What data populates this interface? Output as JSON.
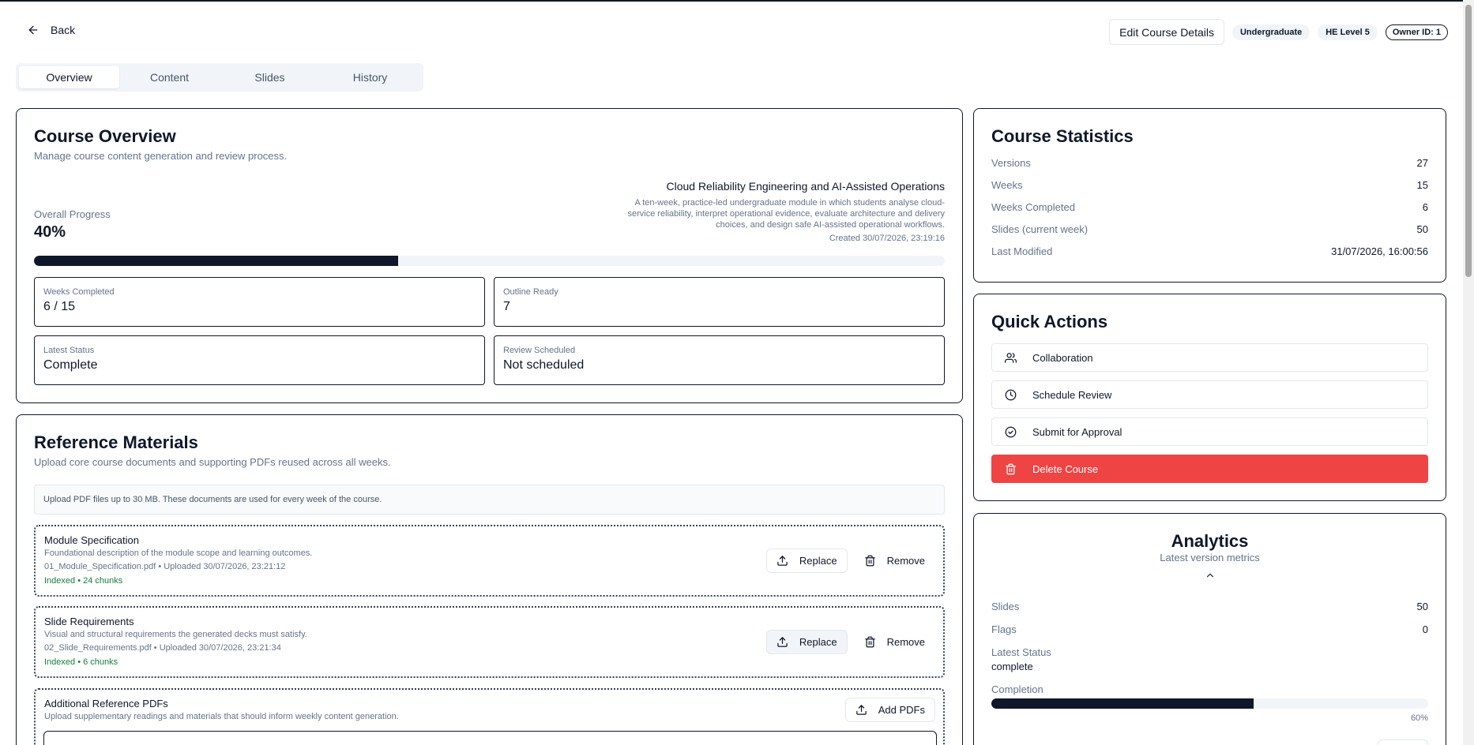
{
  "header": {
    "back_label": "Back",
    "edit_label": "Edit Course Details",
    "badges": [
      "Undergraduate",
      "HE Level 5"
    ],
    "owner_badge": "Owner ID: 1"
  },
  "tabs": [
    {
      "label": "Overview",
      "active": true
    },
    {
      "label": "Content",
      "active": false
    },
    {
      "label": "Slides",
      "active": false
    },
    {
      "label": "History",
      "active": false
    }
  ],
  "overview": {
    "title": "Course Overview",
    "subtitle": "Manage course content generation and review process.",
    "course_name": "Cloud Reliability Engineering and AI-Assisted Operations",
    "course_description": "A ten-week, practice-led undergraduate module in which students analyse cloud-service reliability, interpret operational evidence, evaluate architecture and delivery choices, and design safe AI-assisted operational workflows.",
    "created": "Created 30/07/2026, 23:19:16",
    "progress_label": "Overall Progress",
    "progress_value": "40%",
    "progress_fraction": 0.4,
    "boxes": [
      {
        "label": "Weeks Completed",
        "value": "6 / 15"
      },
      {
        "label": "Outline Ready",
        "value": "7"
      },
      {
        "label": "Latest Status",
        "value": "Complete"
      },
      {
        "label": "Review Scheduled",
        "value": "Not scheduled"
      }
    ]
  },
  "reference": {
    "title": "Reference Materials",
    "subtitle": "Upload core course documents and supporting PDFs reused across all weeks.",
    "info": "Upload PDF files up to 30 MB. These documents are used for every week of the course.",
    "items": [
      {
        "title": "Module Specification",
        "description": "Foundational description of the module scope and learning outcomes.",
        "file": "01_Module_Specification.pdf • Uploaded 30/07/2026, 23:21:12",
        "index": "Indexed • 24 chunks"
      },
      {
        "title": "Slide Requirements",
        "description": "Visual and structural requirements the generated decks must satisfy.",
        "file": "02_Slide_Requirements.pdf • Uploaded 30/07/2026, 23:21:34",
        "index": "Indexed • 6 chunks"
      }
    ],
    "replace_label": "Replace",
    "remove_label": "Remove",
    "additional": {
      "title": "Additional Reference PDFs",
      "description": "Upload supplementary readings and materials that should inform weekly content generation.",
      "add_label": "Add PDFs"
    }
  },
  "statistics": {
    "title": "Course Statistics",
    "rows": [
      {
        "key": "Versions",
        "value": "27"
      },
      {
        "key": "Weeks",
        "value": "15"
      },
      {
        "key": "Weeks Completed",
        "value": "6"
      },
      {
        "key": "Slides (current week)",
        "value": "50"
      },
      {
        "key": "Last Modified",
        "value": "31/07/2026, 16:00:56"
      }
    ]
  },
  "quick_actions": {
    "title": "Quick Actions",
    "items": [
      {
        "label": "Collaboration",
        "icon": "users-icon"
      },
      {
        "label": "Schedule Review",
        "icon": "clock-icon"
      },
      {
        "label": "Submit for Approval",
        "icon": "check-circle-icon"
      },
      {
        "label": "Delete Course",
        "icon": "trash-icon"
      }
    ],
    "danger_color": "#ef4444"
  },
  "analytics": {
    "title": "Analytics",
    "subtitle": "Latest version metrics",
    "slides_label": "Slides",
    "slides_value": "50",
    "flags_label": "Flags",
    "flags_value": "0",
    "status_label": "Latest Status",
    "status_value": "complete",
    "completion_label": "Completion",
    "completion_fraction": 0.6,
    "completion_text": "60%"
  }
}
